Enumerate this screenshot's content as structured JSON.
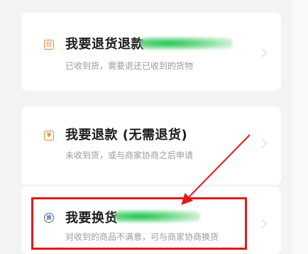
{
  "options": [
    {
      "icon": "refund-return-icon",
      "icon_glyph": "⊡",
      "title": "我要退货退款",
      "subtitle": "已收到货，需要退还已收到的货物"
    },
    {
      "icon": "refund-only-icon",
      "icon_glyph": "¥",
      "title": "我要退款 (无需退货)",
      "subtitle": "未收到货，或与商家协商之后申请"
    },
    {
      "icon": "exchange-icon",
      "icon_glyph": "换",
      "title": "我要换货",
      "subtitle": "对收到的商品不满意，可与商家协商换货"
    }
  ],
  "colors": {
    "accent_orange": "#e3872f",
    "exchange_blue": "#4a62a8",
    "annotation_red": "#e01a1a",
    "redaction_green": "#19c24a"
  }
}
